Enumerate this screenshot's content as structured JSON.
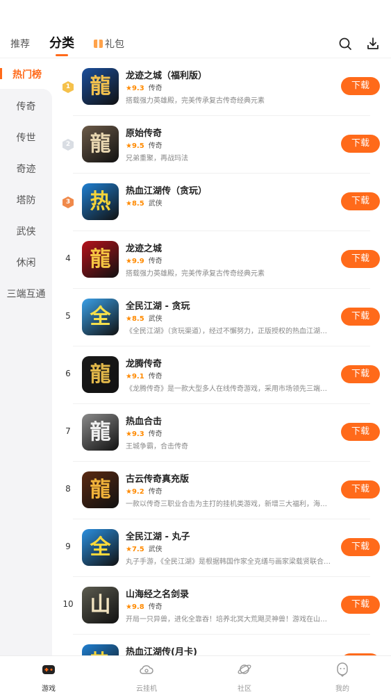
{
  "top_tabs": {
    "recommend": "推荐",
    "category": "分类",
    "gift": "礼包"
  },
  "icons": {
    "search": "search-icon",
    "download": "download-icon"
  },
  "colors": {
    "accent": "#ff6a1a",
    "star": "#ff8a00",
    "sidebar_bg": "#f4f4f6"
  },
  "sidebar": {
    "active": "热门榜",
    "items": [
      "传奇",
      "传世",
      "奇迹",
      "塔防",
      "武侠",
      "休闲",
      "三端互通"
    ]
  },
  "games": [
    {
      "rank": "1",
      "name": "龙迹之城（福利版）",
      "score": "9.3",
      "genre": "传奇",
      "desc": "搭载强力英雄殿，完美传承复古传奇经典元素",
      "glyph": "龍",
      "button": "下载"
    },
    {
      "rank": "2",
      "name": "原始传奇",
      "score": "9.5",
      "genre": "传奇",
      "desc": "兄弟重聚，再战玛法",
      "glyph": "龍",
      "button": "下载"
    },
    {
      "rank": "3",
      "name": "热血江湖传（贪玩）",
      "score": "8.5",
      "genre": "武侠",
      "desc": "",
      "glyph": "热",
      "button": "下载"
    },
    {
      "rank": "4",
      "name": "龙迹之城",
      "score": "9.9",
      "genre": "传奇",
      "desc": "搭载强力英雄殿，完美传承复古传奇经典元素",
      "glyph": "龍",
      "button": "下载"
    },
    {
      "rank": "5",
      "name": "全民江湖 - 贪玩",
      "score": "8.5",
      "genre": "武侠",
      "desc": "《全民江湖》（贪玩渠道），经过不懈努力，正版授权的热血江湖手游",
      "glyph": "全",
      "button": "下载"
    },
    {
      "rank": "6",
      "name": "龙腾传奇",
      "score": "9.1",
      "genre": "传奇",
      "desc": "《龙腾传奇》是一款大型多人在线传奇游戏，采用市场领先三端互通技术",
      "glyph": "龍",
      "button": "下载"
    },
    {
      "rank": "7",
      "name": "热血合击",
      "score": "9.3",
      "genre": "传奇",
      "desc": "王城争霸，合击传奇",
      "glyph": "龍",
      "button": "下载"
    },
    {
      "rank": "8",
      "name": "古云传奇真充版",
      "score": "9.2",
      "genre": "传奇",
      "desc": "一款以传奇三职业合击为主打的挂机类游戏，新增三大福利，海量福利送不停",
      "glyph": "龍",
      "button": "下载"
    },
    {
      "rank": "9",
      "name": "全民江湖 - 丸子",
      "score": "7.5",
      "genre": "武侠",
      "desc": "丸子手游，《全民江湖》是根据韩国作家全克缮与画家梁载贤联合创作的漫画改编",
      "glyph": "全",
      "button": "下载"
    },
    {
      "rank": "10",
      "name": "山海经之名剑录",
      "score": "9.8",
      "genre": "传奇",
      "desc": "开局一只异兽，进化全靠吞！培养北冥大荒飓灵神兽！游戏在山海经的背景下展开",
      "glyph": "山",
      "button": "下载"
    },
    {
      "rank": "11",
      "name": "热血江湖传(月卡)",
      "score": "",
      "genre": "",
      "desc": "",
      "glyph": "热",
      "button": "下载"
    }
  ],
  "bottom_nav": [
    {
      "label": "游戏",
      "icon": "gamepad-icon"
    },
    {
      "label": "云挂机",
      "icon": "cloud-icon"
    },
    {
      "label": "社区",
      "icon": "planet-icon"
    },
    {
      "label": "我的",
      "icon": "profile-icon"
    }
  ]
}
